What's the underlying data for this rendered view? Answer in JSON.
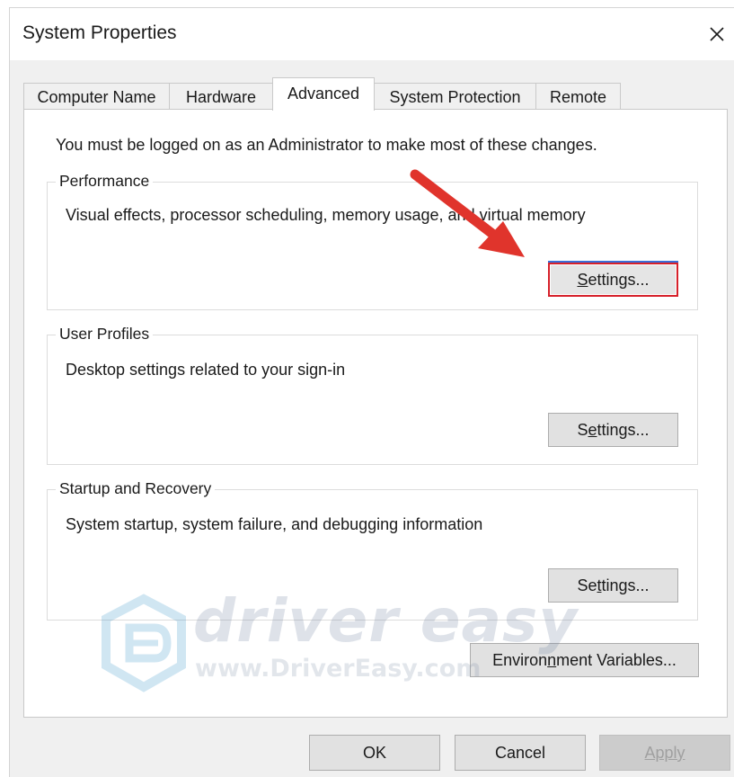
{
  "window": {
    "title": "System Properties",
    "close_icon": "close-icon"
  },
  "tabs": [
    {
      "label": "Computer Name"
    },
    {
      "label": "Hardware"
    },
    {
      "label": "Advanced"
    },
    {
      "label": "System Protection"
    },
    {
      "label": "Remote"
    }
  ],
  "active_tab": "Advanced",
  "panel": {
    "note": "You must be logged on as an Administrator to make most of these changes."
  },
  "groups": {
    "performance": {
      "legend": "Performance",
      "description": "Visual effects, processor scheduling, memory usage, and virtual memory",
      "button": {
        "pre": "",
        "underline": "S",
        "post": "ettings..."
      }
    },
    "user_profiles": {
      "legend": "User Profiles",
      "description": "Desktop settings related to your sign-in",
      "button": {
        "pre": "S",
        "underline": "e",
        "post": "ttings..."
      }
    },
    "startup_recovery": {
      "legend": "Startup and Recovery",
      "description": "System startup, system failure, and debugging information",
      "button": {
        "pre": "Se",
        "underline": "t",
        "post": "tings..."
      }
    }
  },
  "environment_button": {
    "pre": "Environ",
    "underline": "n",
    "post": "ment Variables..."
  },
  "footer": {
    "ok": "OK",
    "cancel": "Cancel",
    "apply": "Apply"
  },
  "watermark": {
    "brand": "driver easy",
    "url": "www.DriverEasy.com"
  },
  "colors": {
    "highlight_border": "#d6202a",
    "arrow": "#e0342c",
    "dialog_background": "#f0f0f0"
  }
}
